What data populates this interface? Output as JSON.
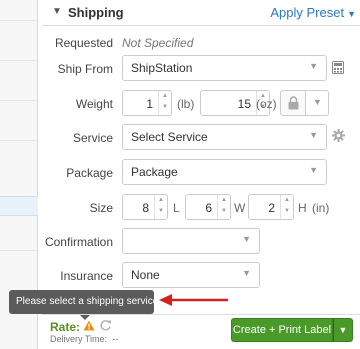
{
  "shipping": {
    "title": "Shipping",
    "apply_preset": "Apply Preset"
  },
  "fields": {
    "requested_label": "Requested",
    "requested_value": "Not Specified",
    "ship_from_label": "Ship From",
    "ship_from_value": "ShipStation",
    "weight_label": "Weight",
    "weight_lb": "1",
    "weight_lb_unit": "(lb)",
    "weight_oz": "15",
    "weight_oz_unit": "(oz)",
    "service_label": "Service",
    "service_value": "Select Service",
    "package_label": "Package",
    "package_value": "Package",
    "size_label": "Size",
    "size_l": "8",
    "size_l_unit": "L",
    "size_w": "6",
    "size_w_unit": "W",
    "size_h": "2",
    "size_h_unit": "H",
    "size_unit": "(in)",
    "confirmation_label": "Confirmation",
    "confirmation_value": "",
    "insurance_label": "Insurance",
    "insurance_value": "None"
  },
  "tooltip": {
    "text": "Please select a shipping service."
  },
  "footer": {
    "rate_label": "Rate:",
    "delivery_label": "Delivery Time:",
    "delivery_value": "--",
    "create_button": "Create + Print Label"
  },
  "colors": {
    "accent": "#2b7bc0",
    "green": "#4a9a2a",
    "warning": "#e8900c",
    "arrow_red": "#d42020"
  },
  "icons": {
    "header_caret": "caret-down-icon",
    "calculator": "calculator-icon",
    "lock": "lock-icon",
    "gear": "gear-icon",
    "warning": "warning-icon",
    "refresh": "refresh-icon"
  }
}
